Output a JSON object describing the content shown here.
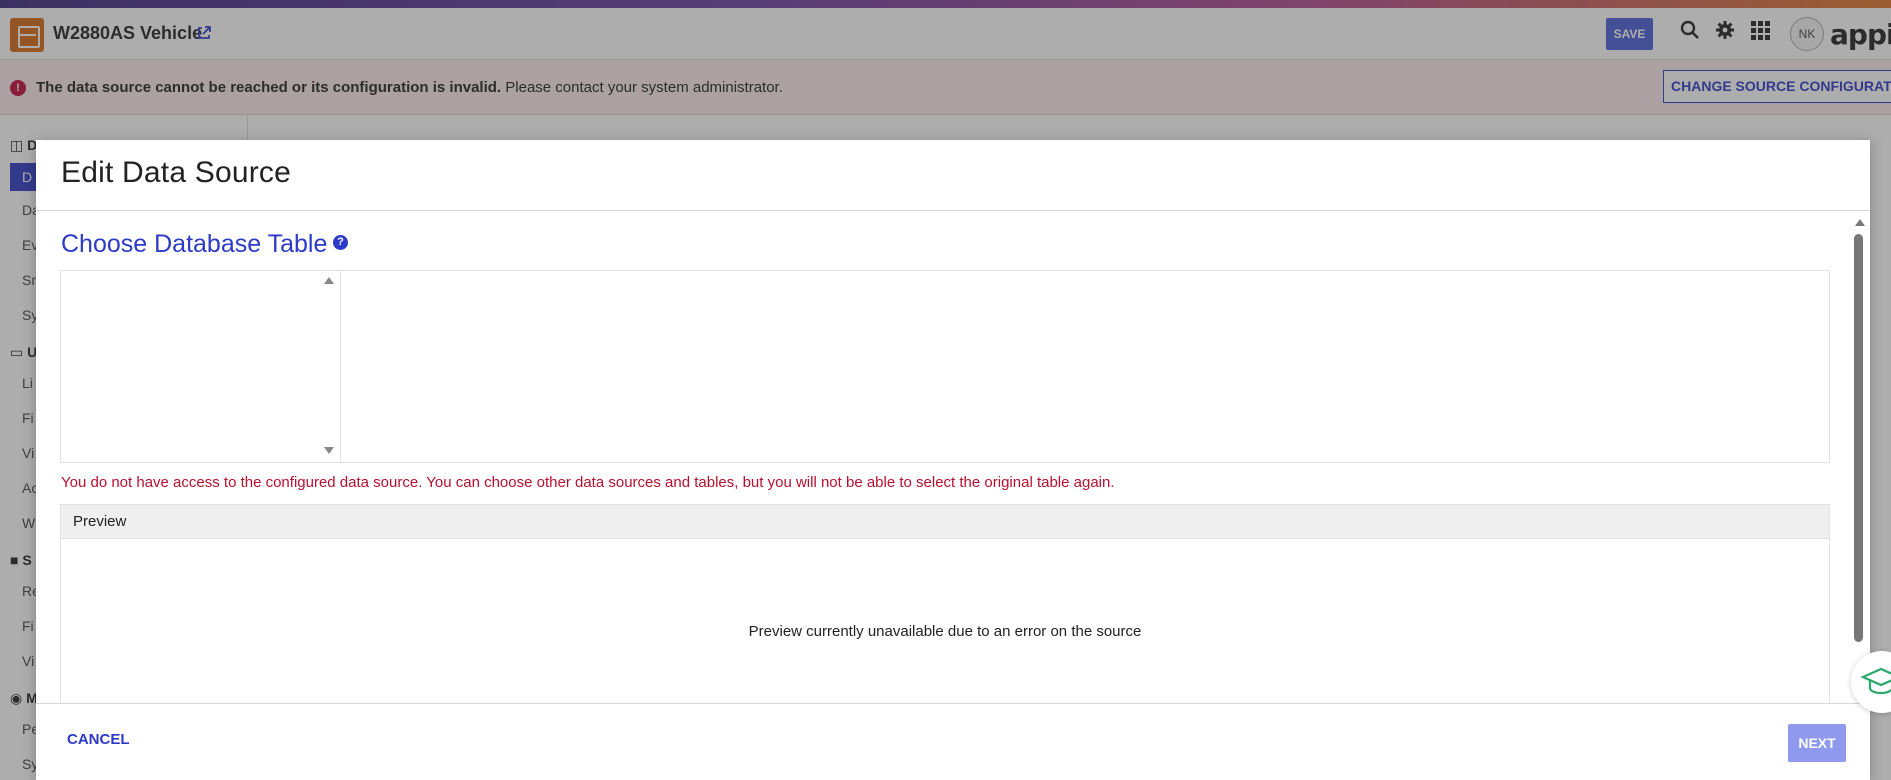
{
  "header": {
    "title": "W2880AS Vehicle",
    "save_label": "SAVE",
    "user_initials": "NK",
    "brand": "appian",
    "external_link_icon": "external-link-icon",
    "icons": [
      "search-icon",
      "gear-icon",
      "app-grid-icon"
    ]
  },
  "error_bar": {
    "bold_message": "The data source cannot be reached or its configuration is invalid.",
    "message": " Please contact your system administrator.",
    "action_label": "CHANGE SOURCE CONFIGURATION"
  },
  "sidebar": {
    "items": [
      {
        "type": "head",
        "label": "D"
      },
      {
        "type": "active",
        "label": "D"
      },
      {
        "type": "item",
        "label": "Da"
      },
      {
        "type": "item",
        "label": "Ev"
      },
      {
        "type": "item",
        "label": "Sr"
      },
      {
        "type": "item",
        "label": "Sy"
      },
      {
        "type": "head",
        "label": "U"
      },
      {
        "type": "item",
        "label": "Li"
      },
      {
        "type": "item",
        "label": "Fi"
      },
      {
        "type": "item",
        "label": "Vi"
      },
      {
        "type": "item",
        "label": "Ac"
      },
      {
        "type": "item",
        "label": "W"
      },
      {
        "type": "head",
        "label": "S"
      },
      {
        "type": "item",
        "label": "Re"
      },
      {
        "type": "item",
        "label": "Fi"
      },
      {
        "type": "item",
        "label": "Vi"
      },
      {
        "type": "head",
        "label": "M"
      },
      {
        "type": "item",
        "label": "Pe"
      },
      {
        "type": "item",
        "label": "Sy"
      }
    ]
  },
  "modal": {
    "title": "Edit Data Source",
    "section_title": "Choose Database Table",
    "access_message": "You do not have access to the configured data source. You can choose other data sources and tables, but you will not be able to select the original table again.",
    "preview_header": "Preview",
    "preview_message": "Preview currently unavailable due to an error on the source",
    "cancel_label": "CANCEL",
    "next_label": "NEXT"
  },
  "colors": {
    "accent": "#2d3ac7",
    "error": "#b8102e",
    "app_icon": "#d86a14",
    "disabled_primary": "#8f99ee"
  }
}
